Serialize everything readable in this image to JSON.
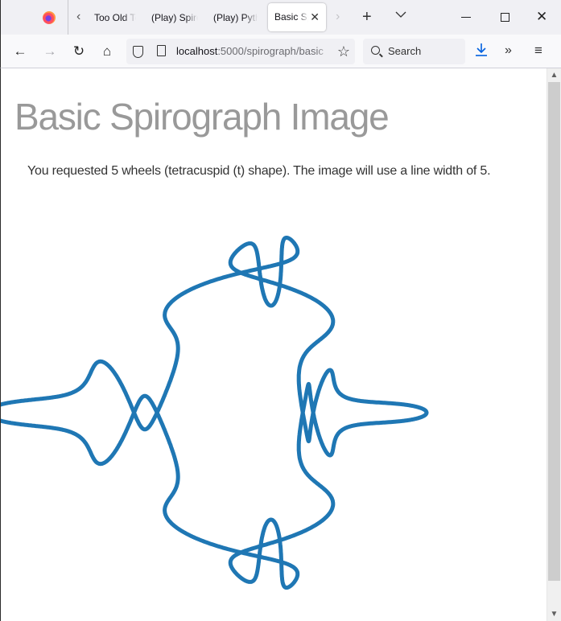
{
  "browser": {
    "tabs": [
      {
        "label": "Too Old To",
        "active": false
      },
      {
        "label": "(Play) Spirograph",
        "active": false
      },
      {
        "label": "(Play) Python",
        "active": false
      },
      {
        "label": "Basic Spirograph Image",
        "active": true
      }
    ],
    "active_tab_label": "Basic Sp",
    "icons": {
      "logo": "firefox-logo",
      "tab_scroll_left": "‹",
      "tab_scroll_right": "›",
      "tab_close": "✕",
      "new_tab": "+",
      "tab_list": "⌄",
      "window_close": "✕",
      "back": "←",
      "forward": "→",
      "reload": "↻",
      "home": "⌂",
      "star": "☆",
      "download": "⤓",
      "overflow": "»",
      "menu": "≡",
      "scroll_up": "▲",
      "scroll_down": "▼"
    },
    "url": {
      "host": "localhost",
      "rest": ":5000/spirograph/basic"
    },
    "search_placeholder": "Search"
  },
  "page": {
    "title": "Basic Spirograph Image",
    "description": "You requested 5 wheels (tetracuspid (t) shape). The image will use a line width of 5.",
    "spirograph": {
      "wheels": 5,
      "shape": "tetracuspid (t)",
      "line_width": 5,
      "stroke_color": "#1f77b4"
    }
  },
  "scrollbar": {
    "position_fraction": 0.0,
    "visible_fraction": 0.97
  }
}
